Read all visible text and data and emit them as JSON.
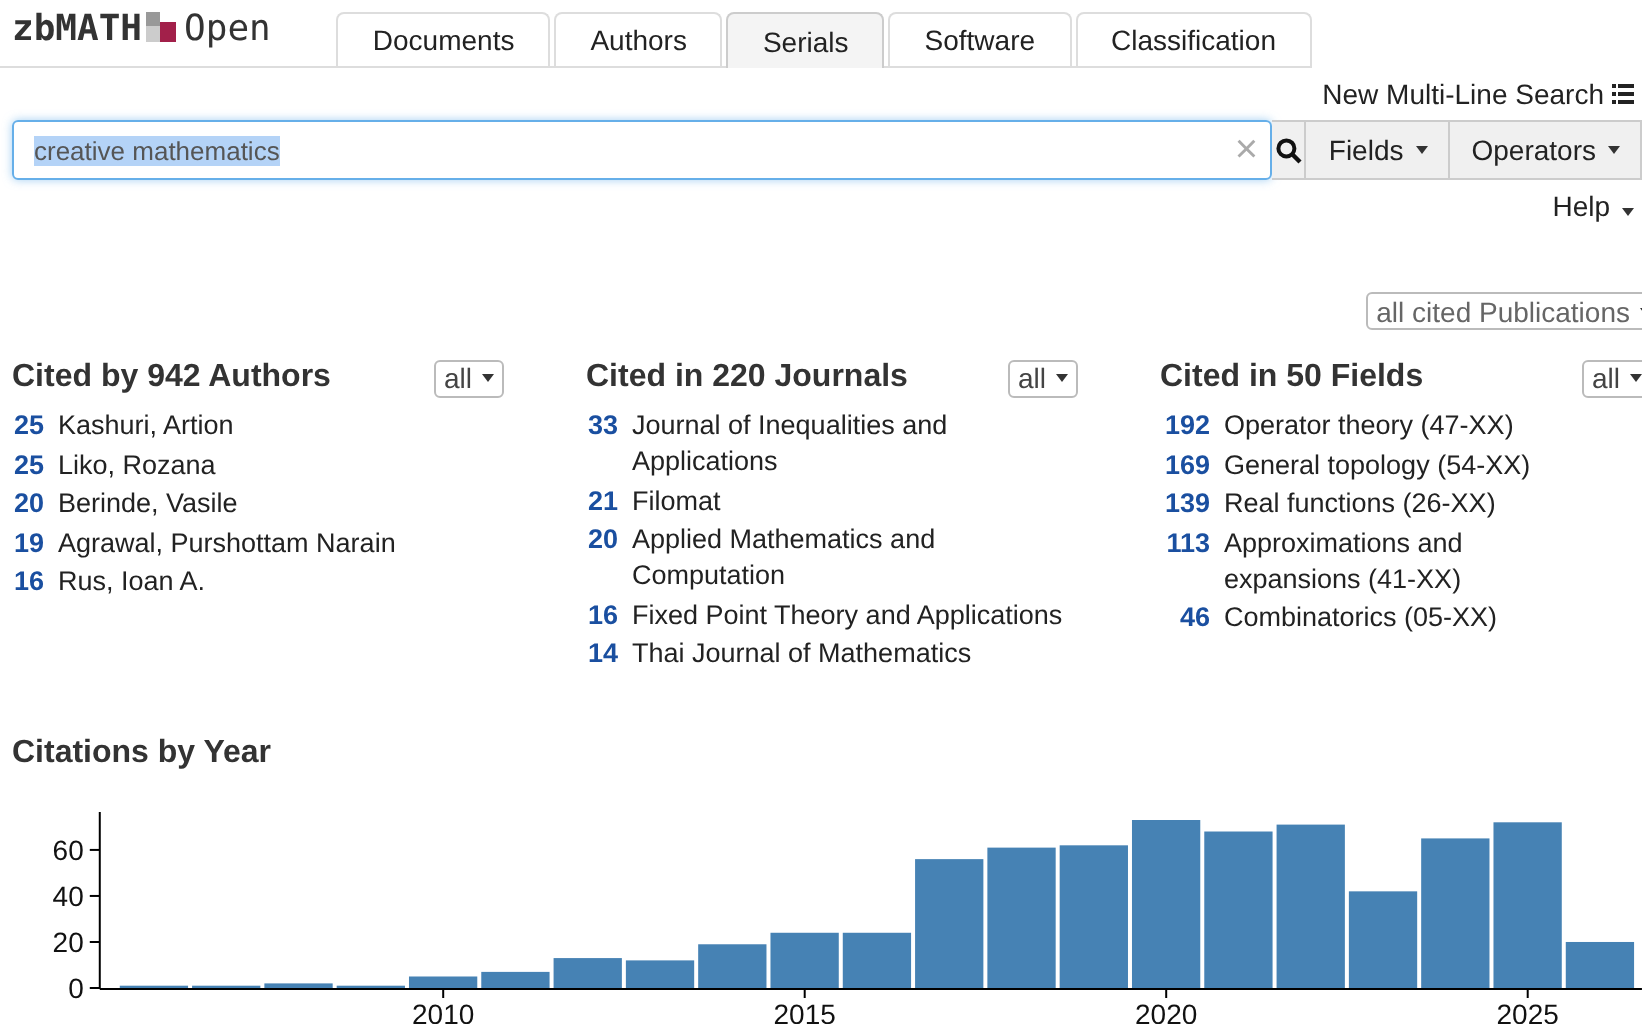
{
  "logo": {
    "brand": "zbMATH",
    "suffix": "Open"
  },
  "tabs": [
    {
      "label": "Documents",
      "selected": false
    },
    {
      "label": "Authors",
      "selected": false
    },
    {
      "label": "Serials",
      "selected": true
    },
    {
      "label": "Software",
      "selected": false
    },
    {
      "label": "Classification",
      "selected": false
    }
  ],
  "multi_line_search": "New Multi-Line Search",
  "search": {
    "value": "creative mathematics",
    "text_selected": true,
    "clear": "×"
  },
  "fields_button": "Fields",
  "operators_button": "Operators",
  "help": "Help",
  "publications_filter": "all cited Publications",
  "panels": [
    {
      "title": "Cited by 942 Authors",
      "filter": "all",
      "items": [
        {
          "count": "25",
          "label": "Kashuri, Artion"
        },
        {
          "count": "25",
          "label": "Liko, Rozana"
        },
        {
          "count": "20",
          "label": "Berinde, Vasile"
        },
        {
          "count": "19",
          "label": "Agrawal, Purshottam Narain"
        },
        {
          "count": "16",
          "label": "Rus, Ioan A."
        }
      ]
    },
    {
      "title": "Cited in 220 Journals",
      "filter": "all",
      "items": [
        {
          "count": "33",
          "label": "Journal of Inequalities and Applications"
        },
        {
          "count": "21",
          "label": "Filomat"
        },
        {
          "count": "20",
          "label": "Applied Mathematics and Computation"
        },
        {
          "count": "16",
          "label": "Fixed Point Theory and Applications"
        },
        {
          "count": "14",
          "label": "Thai Journal of Mathematics"
        }
      ]
    },
    {
      "title": "Cited in 50 Fields",
      "filter": "all",
      "items": [
        {
          "count": "192",
          "label": "Operator theory (47-XX)"
        },
        {
          "count": "169",
          "label": "General topology (54-XX)"
        },
        {
          "count": "139",
          "label": "Real functions (26-XX)"
        },
        {
          "count": "113",
          "label": "Approximations and expansions (41-XX)"
        },
        {
          "count": "46",
          "label": "Combinatorics (05-XX)"
        }
      ]
    }
  ],
  "citations": {
    "title": "Citations by Year",
    "chart_data": {
      "type": "bar",
      "x": [
        2006,
        2007,
        2008,
        2009,
        2010,
        2011,
        2012,
        2013,
        2014,
        2015,
        2016,
        2017,
        2018,
        2019,
        2020,
        2021,
        2022,
        2023,
        2024,
        2025,
        2026
      ],
      "series": [
        {
          "color": "#4682b4",
          "values": [
            1,
            1,
            2,
            1,
            5,
            7,
            13,
            12,
            19,
            24,
            24,
            56,
            61,
            62,
            73,
            68,
            71,
            42,
            65,
            72,
            20
          ]
        }
      ],
      "xlim": [
        2005.25,
        2026.58
      ],
      "ylim": [
        0,
        73
      ],
      "yticks": [
        {
          "value": 0,
          "label": "0"
        },
        {
          "value": 20,
          "label": "20"
        },
        {
          "value": 40,
          "label": "40"
        },
        {
          "value": 60,
          "label": "60"
        }
      ],
      "xticks": [
        {
          "value": 2010,
          "label": "2010"
        },
        {
          "value": 2015,
          "label": "2015"
        },
        {
          "value": 2020,
          "label": "2020"
        },
        {
          "value": 2025,
          "label": "2025"
        }
      ]
    }
  }
}
